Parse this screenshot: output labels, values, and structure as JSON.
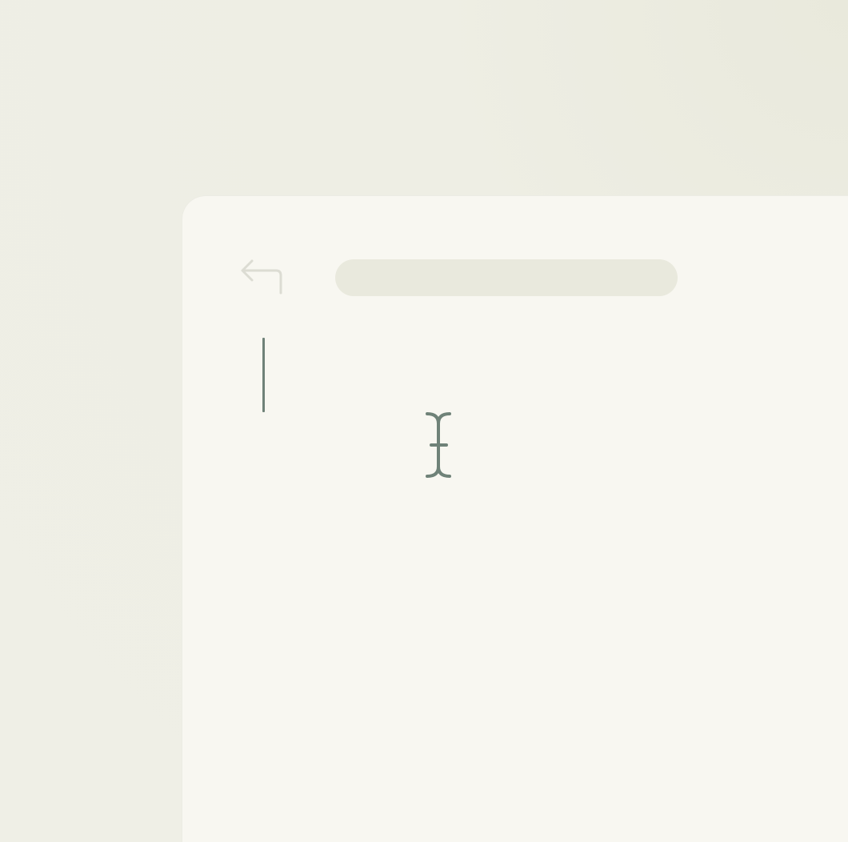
{
  "address_bar": {
    "value": "",
    "placeholder": ""
  },
  "editor": {
    "text": ""
  },
  "icons": {
    "back": "back-arrow-icon",
    "cursor": "ibeam-cursor-icon"
  },
  "colors": {
    "desktop": "#efefe6",
    "window": "#f8f7f1",
    "address_bar": "#e9e9dd",
    "caret": "#6f8278"
  }
}
